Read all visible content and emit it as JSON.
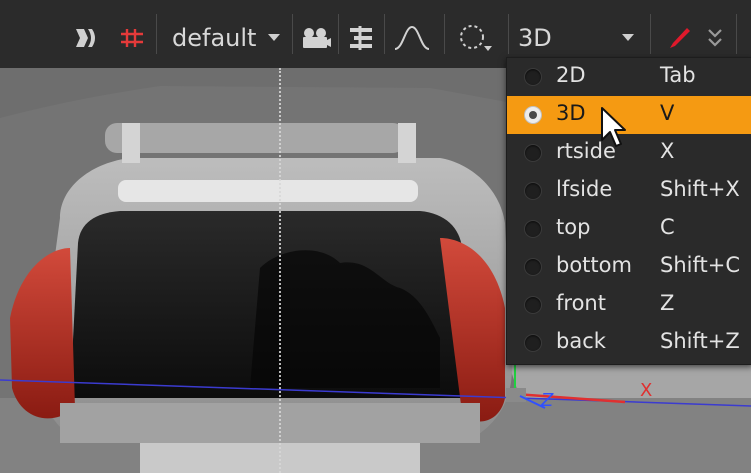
{
  "toolbar": {
    "preset_dropdown": {
      "value": "default"
    },
    "view_dropdown": {
      "value": "3D"
    },
    "icons": [
      "stereo-toggle-icon",
      "grid-icon",
      "camera-icon",
      "align-icon",
      "curve-icon",
      "selection-icon",
      "paint-brush-icon",
      "more-icon"
    ],
    "colors": {
      "background": "#2b2b2b",
      "grid_icon": "#e43a3a",
      "brush_icon": "#e0192b"
    }
  },
  "view_menu": {
    "items": [
      {
        "name": "2D",
        "shortcut": "Tab",
        "selected": false
      },
      {
        "name": "3D",
        "shortcut": "V",
        "selected": true
      },
      {
        "name": "rtside",
        "shortcut": "X",
        "selected": false
      },
      {
        "name": "lfside",
        "shortcut": "Shift+X",
        "selected": false
      },
      {
        "name": "top",
        "shortcut": "C",
        "selected": false
      },
      {
        "name": "bottom",
        "shortcut": "Shift+C",
        "selected": false
      },
      {
        "name": "front",
        "shortcut": "Z",
        "selected": false
      },
      {
        "name": "back",
        "shortcut": "Shift+Z",
        "selected": false
      }
    ],
    "highlight_color": "#f59a12"
  },
  "viewer": {
    "axis_labels": {
      "x": "X",
      "z": "Z"
    },
    "axis_colors": {
      "x": "#e03030",
      "y": "#20d040",
      "z": "#3050ff"
    }
  }
}
